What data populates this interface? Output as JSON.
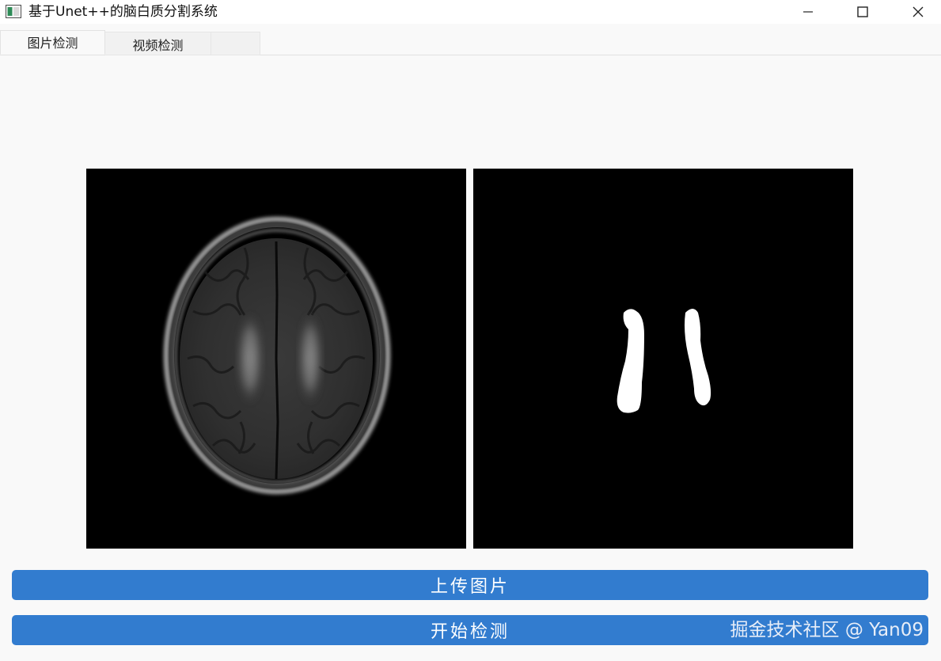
{
  "window": {
    "title": "基于Unet++的脑白质分割系统",
    "icon": "app-window-icon",
    "controls": [
      "minimize-icon",
      "maximize-icon",
      "close-icon"
    ]
  },
  "tabs": [
    {
      "label": "图片检测",
      "selected": true
    },
    {
      "label": "视频检测",
      "selected": false
    },
    {
      "label": "",
      "selected": false
    }
  ],
  "panels": {
    "original": {
      "content": "brain-mri-flair-axial"
    },
    "result": {
      "content": "white-matter-segmentation-mask"
    }
  },
  "buttons": {
    "upload_label": "上传图片",
    "detect_label": "开始检测"
  },
  "watermark": "掘金技术社区 @ Yan09",
  "colors": {
    "accent": "#327ccf",
    "background": "#f9f9f9",
    "panel_bg": "#000000"
  }
}
